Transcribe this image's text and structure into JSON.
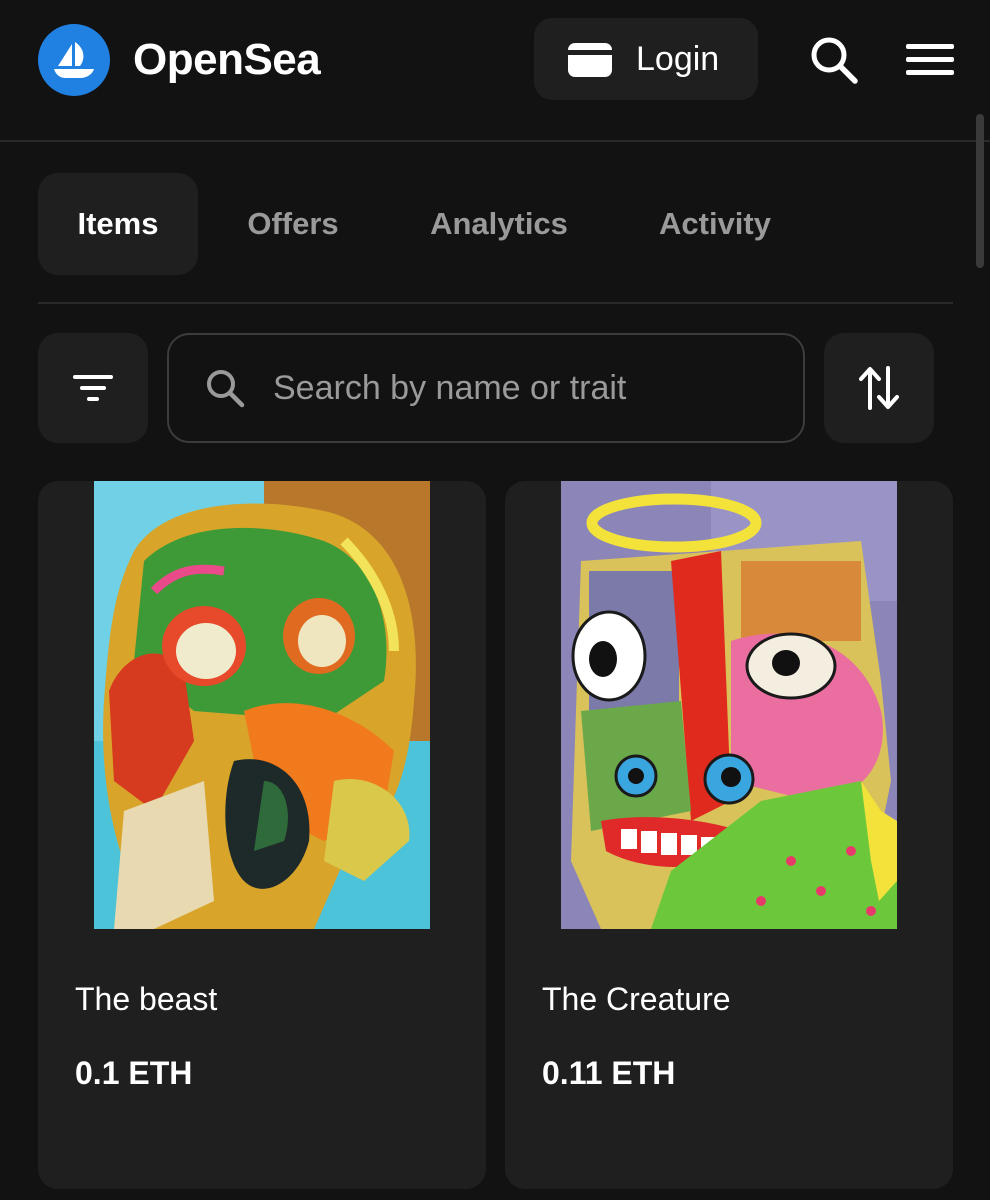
{
  "header": {
    "brand": "OpenSea",
    "login_label": "Login",
    "brand_color": "#2081e2"
  },
  "tabs": [
    {
      "label": "Items",
      "active": true
    },
    {
      "label": "Offers",
      "active": false
    },
    {
      "label": "Analytics",
      "active": false
    },
    {
      "label": "Activity",
      "active": false
    }
  ],
  "filters": {
    "search_placeholder": "Search by name or trait",
    "search_value": ""
  },
  "items": [
    {
      "name": "The beast",
      "price": "0.1 ETH"
    },
    {
      "name": "The Creature",
      "price": "0.11 ETH"
    }
  ],
  "icons": {
    "logo": "opensea-boat-icon",
    "wallet": "wallet-icon",
    "search": "search-icon",
    "menu": "hamburger-menu-icon",
    "filter": "filter-lines-icon",
    "sort": "sort-arrows-icon"
  }
}
